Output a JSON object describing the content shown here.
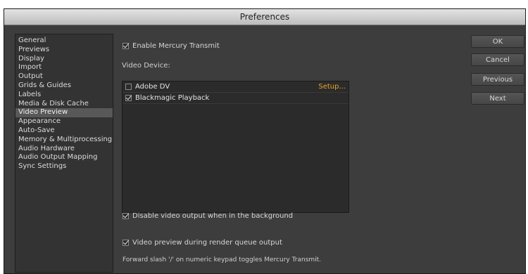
{
  "window": {
    "title": "Preferences"
  },
  "sidebar": {
    "items": [
      {
        "label": "General",
        "selected": false
      },
      {
        "label": "Previews",
        "selected": false
      },
      {
        "label": "Display",
        "selected": false
      },
      {
        "label": "Import",
        "selected": false
      },
      {
        "label": "Output",
        "selected": false
      },
      {
        "label": "Grids & Guides",
        "selected": false
      },
      {
        "label": "Labels",
        "selected": false
      },
      {
        "label": "Media & Disk Cache",
        "selected": false
      },
      {
        "label": "Video Preview",
        "selected": true
      },
      {
        "label": "Appearance",
        "selected": false
      },
      {
        "label": "Auto-Save",
        "selected": false
      },
      {
        "label": "Memory & Multiprocessing",
        "selected": false
      },
      {
        "label": "Audio Hardware",
        "selected": false
      },
      {
        "label": "Audio Output Mapping",
        "selected": false
      },
      {
        "label": "Sync Settings",
        "selected": false
      }
    ]
  },
  "main": {
    "enable_mercury": {
      "label": "Enable Mercury Transmit",
      "checked": true
    },
    "video_device_label": "Video Device:",
    "devices": [
      {
        "label": "Adobe DV",
        "checked": false,
        "setup_label": "Setup..."
      },
      {
        "label": "Blackmagic Playback",
        "checked": true
      }
    ],
    "disable_background": {
      "label": "Disable video output when in the background",
      "checked": true
    },
    "render_queue": {
      "label": "Video preview during render queue output",
      "checked": true
    },
    "note": "Forward slash '/' on numeric keypad toggles Mercury Transmit."
  },
  "buttons": {
    "ok": "OK",
    "cancel": "Cancel",
    "previous": "Previous",
    "next": "Next"
  },
  "colors": {
    "panel": "#3d3d3d",
    "selected": "#585858",
    "link": "#e7a52a"
  }
}
